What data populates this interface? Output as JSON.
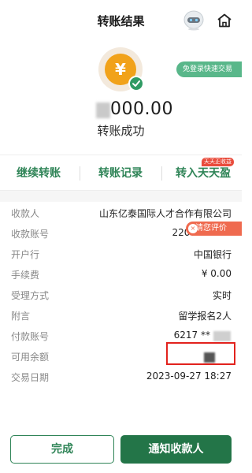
{
  "header": {
    "title": "转账结果",
    "robot_icon": "robot-assistant-icon",
    "home_icon": "home-icon"
  },
  "hero": {
    "coin_symbol": "¥",
    "quick_login_label": "免登录快速交易",
    "amount": "000.00",
    "status": "转账成功"
  },
  "actions": {
    "continue_transfer": "继续转账",
    "transfer_records": "转账记录",
    "tiantianying": "转入天天盈",
    "badge": "天天正收益"
  },
  "review_popup": {
    "label": "请您评价",
    "close_icon": "×"
  },
  "details": [
    {
      "label": "收款人",
      "value": "山东亿泰国际人才合作有限公司"
    },
    {
      "label": "收款账号",
      "value": "2208"
    },
    {
      "label": "开户行",
      "value": "中国银行"
    },
    {
      "label": "手续费",
      "value": "¥ 0.00"
    },
    {
      "label": "受理方式",
      "value": "实时"
    },
    {
      "label": "附言",
      "value": "留学报名2人"
    },
    {
      "label": "付款账号",
      "value": "6217 **"
    },
    {
      "label": "可用余额",
      "value": ""
    },
    {
      "label": "交易日期",
      "value": "2023-09-27 18:27"
    }
  ],
  "footer": {
    "done": "完成",
    "notify_payee": "通知收款人"
  },
  "colors": {
    "brand_green": "#237548",
    "accent_green": "#2f8457",
    "coin_orange": "#f1a21a",
    "highlight_red": "#e2221d"
  }
}
